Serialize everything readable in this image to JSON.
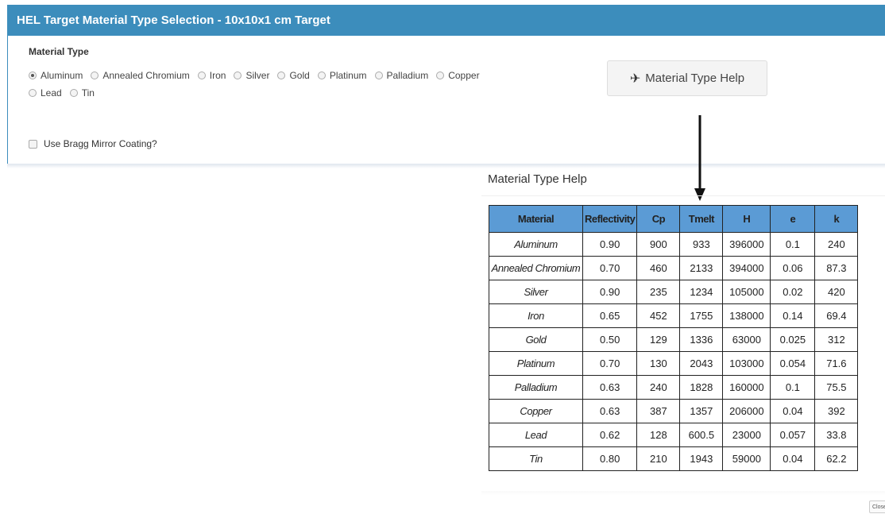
{
  "panel": {
    "title": "HEL Target Material Type Selection - 10x10x1 cm Target",
    "material_type_label": "Material Type",
    "options": [
      "Aluminum",
      "Annealed Chromium",
      "Iron",
      "Silver",
      "Gold",
      "Platinum",
      "Palladium",
      "Copper",
      "Lead",
      "Tin"
    ],
    "selected": "Aluminum",
    "help_button_label": "Material Type Help",
    "help_button_icon": "plane-icon",
    "bragg_label": "Use Bragg Mirror Coating?",
    "bragg_checked": false
  },
  "help": {
    "title": "Material Type Help",
    "headers": [
      "Material",
      "Reflectivity",
      "Cp",
      "Tmelt",
      "H",
      "e",
      "k"
    ],
    "rows": [
      [
        "Aluminum",
        "0.90",
        "900",
        "933",
        "396000",
        "0.1",
        "240"
      ],
      [
        "Annealed Chromium",
        "0.70",
        "460",
        "2133",
        "394000",
        "0.06",
        "87.3"
      ],
      [
        "Silver",
        "0.90",
        "235",
        "1234",
        "105000",
        "0.02",
        "420"
      ],
      [
        "Iron",
        "0.65",
        "452",
        "1755",
        "138000",
        "0.14",
        "69.4"
      ],
      [
        "Gold",
        "0.50",
        "129",
        "1336",
        "63000",
        "0.025",
        "312"
      ],
      [
        "Platinum",
        "0.70",
        "130",
        "2043",
        "103000",
        "0.054",
        "71.6"
      ],
      [
        "Palladium",
        "0.63",
        "240",
        "1828",
        "160000",
        "0.1",
        "75.5"
      ],
      [
        "Copper",
        "0.63",
        "387",
        "1357",
        "206000",
        "0.04",
        "392"
      ],
      [
        "Lead",
        "0.62",
        "128",
        "600.5",
        "23000",
        "0.057",
        "33.8"
      ],
      [
        "Tin",
        "0.80",
        "210",
        "1943",
        "59000",
        "0.04",
        "62.2"
      ]
    ],
    "header_color": "#5b9bd5"
  },
  "footer": {
    "close_label": "Close"
  },
  "colors": {
    "accent": "#3c8dbc"
  }
}
